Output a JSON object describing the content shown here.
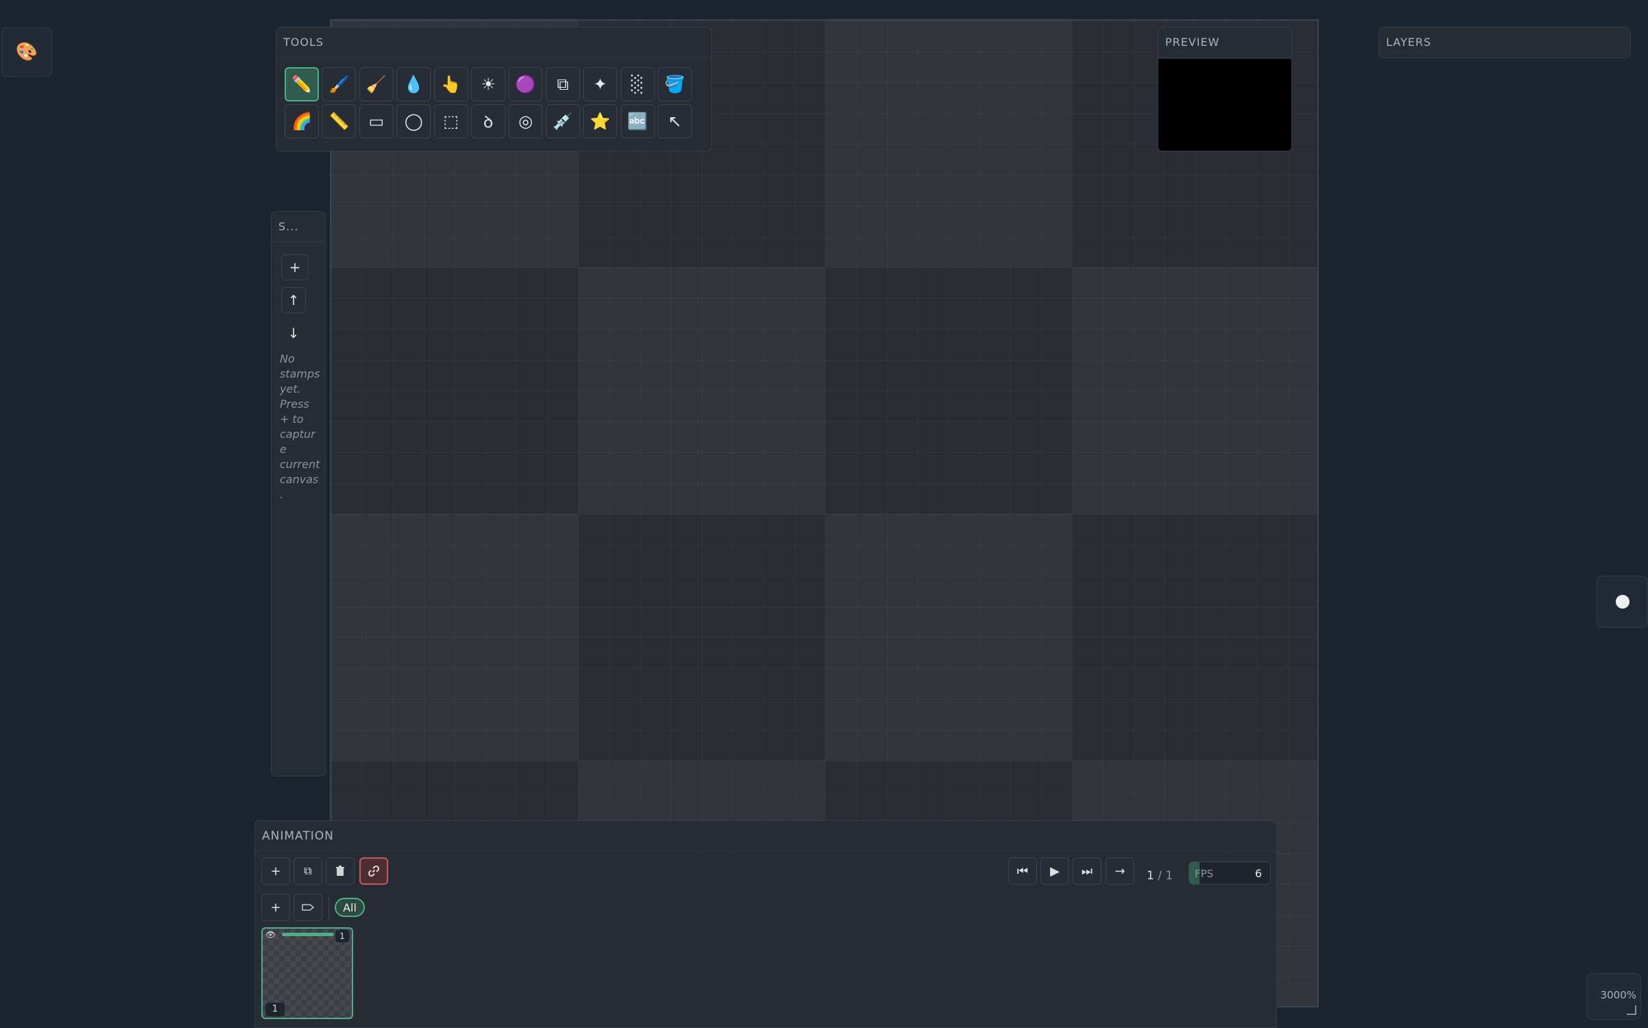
{
  "palette_toggle": {
    "icon": "palette-icon"
  },
  "tools": {
    "title": "TOOLS",
    "items": [
      {
        "name": "pencil",
        "icon": "pencil-icon",
        "glyph": "✏️"
      },
      {
        "name": "brush",
        "icon": "brush-icon",
        "glyph": "🖌️"
      },
      {
        "name": "broom",
        "icon": "broom-icon",
        "glyph": "🧹"
      },
      {
        "name": "water-drop",
        "icon": "water-drop-icon",
        "glyph": "💧"
      },
      {
        "name": "smudge",
        "icon": "finger-icon",
        "glyph": "👆"
      },
      {
        "name": "lighten",
        "icon": "sun-icon",
        "glyph": "☀"
      },
      {
        "name": "sphere",
        "icon": "sphere-icon",
        "glyph": "🟣"
      },
      {
        "name": "clone",
        "icon": "clone-icon",
        "glyph": "⧉"
      },
      {
        "name": "sparkle",
        "icon": "sparkle-icon",
        "glyph": "✦"
      },
      {
        "name": "dither",
        "icon": "dither-icon",
        "glyph": "░"
      },
      {
        "name": "fill-bucket",
        "icon": "bucket-icon",
        "glyph": "🪣"
      },
      {
        "name": "gradient",
        "icon": "rainbow-icon",
        "glyph": "🌈"
      },
      {
        "name": "line",
        "icon": "ruler-icon",
        "glyph": "📏"
      },
      {
        "name": "rectangle",
        "icon": "rectangle-icon",
        "glyph": "▭"
      },
      {
        "name": "ellipse",
        "icon": "ellipse-icon",
        "glyph": "◯"
      },
      {
        "name": "select",
        "icon": "selection-icon",
        "glyph": "⬚"
      },
      {
        "name": "lasso",
        "icon": "lasso-icon",
        "glyph": "ꝺ"
      },
      {
        "name": "ring",
        "icon": "ring-icon",
        "glyph": "◎"
      },
      {
        "name": "eyedropper",
        "icon": "eyedropper-icon",
        "glyph": "💉"
      },
      {
        "name": "stamp",
        "icon": "star-icon",
        "glyph": "⭐"
      },
      {
        "name": "text",
        "icon": "text-icon",
        "glyph": "🔤"
      },
      {
        "name": "move",
        "icon": "arrow-icon",
        "glyph": "↖"
      }
    ],
    "active_index": 0
  },
  "preview": {
    "title": "PREVIEW"
  },
  "layers": {
    "title": "LAYERS"
  },
  "stamps": {
    "title": "S...",
    "add_label": "+",
    "up_label": "↑",
    "down_label": "↓",
    "empty_text": "No stamps yet. Press + to capture current canvas."
  },
  "animation": {
    "title": "ANIMATION",
    "add_frame_label": "+",
    "duplicate_icon": "duplicate-icon",
    "delete_icon": "trash-icon",
    "link_icon": "link-icon",
    "add_tag_label": "+",
    "tag_icon": "tag-icon",
    "filter_all_label": "All",
    "first_frame_glyph": "⏮",
    "play_glyph": "▶",
    "last_frame_glyph": "⏭",
    "next_glyph": "→",
    "current_frame": "1",
    "frame_separator": " / ",
    "total_frames": "1",
    "fps_label": "FPS",
    "fps_value": "6",
    "fps_fraction": 0.13,
    "frames": [
      {
        "index": "1",
        "duration": "1"
      }
    ]
  },
  "zoom": {
    "label": "3000%"
  },
  "colors": {
    "accent": "#49b08a",
    "background": "#1b2530",
    "link_active": "#c45a5a"
  }
}
